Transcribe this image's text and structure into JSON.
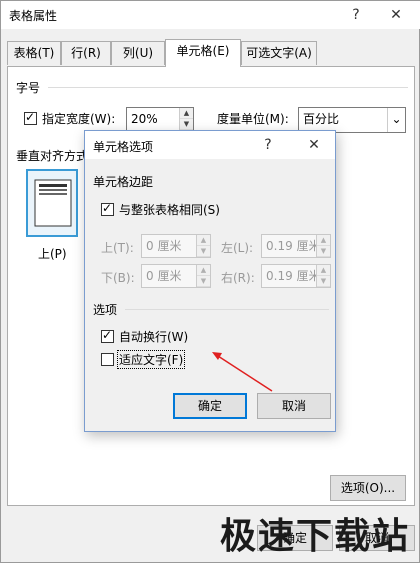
{
  "outer_dialog": {
    "title": "表格属性",
    "help_glyph": "?",
    "close_glyph": "✕",
    "tabs": [
      {
        "label": "表格(T)"
      },
      {
        "label": "行(R)"
      },
      {
        "label": "列(U)"
      },
      {
        "label": "单元格(E)"
      },
      {
        "label": "可选文字(A)"
      }
    ],
    "active_tab_index": 3,
    "size_group_label": "字号",
    "specify_width_label": "指定宽度(W):",
    "specify_width_checked": true,
    "width_value": "20%",
    "measure_unit_label": "度量单位(M):",
    "measure_unit_value": "百分比",
    "vertical_align_label": "垂直对齐方式",
    "align_top_label": "上(P)",
    "options_button": "选项(O)...",
    "ok_button": "确定",
    "cancel_button": "取消"
  },
  "inner_dialog": {
    "title": "单元格选项",
    "help_glyph": "?",
    "close_glyph": "✕",
    "margins_group_label": "单元格边距",
    "same_as_table_label": "与整张表格相同(S)",
    "same_as_table_checked": true,
    "top_label": "上(T):",
    "top_value": "0 厘米",
    "left_label": "左(L):",
    "left_value": "0.19 厘米",
    "bottom_label": "下(B):",
    "bottom_value": "0 厘米",
    "right_label": "右(R):",
    "right_value": "0.19 厘米",
    "options_group_label": "选项",
    "wrap_text_label": "自动换行(W)",
    "wrap_text_checked": true,
    "fit_text_label": "适应文字(F)",
    "fit_text_checked": false,
    "ok_button": "确定",
    "cancel_button": "取消"
  },
  "annotation": {
    "arrow_color": "#e02020"
  },
  "watermark": {
    "text": "极速下载站"
  }
}
